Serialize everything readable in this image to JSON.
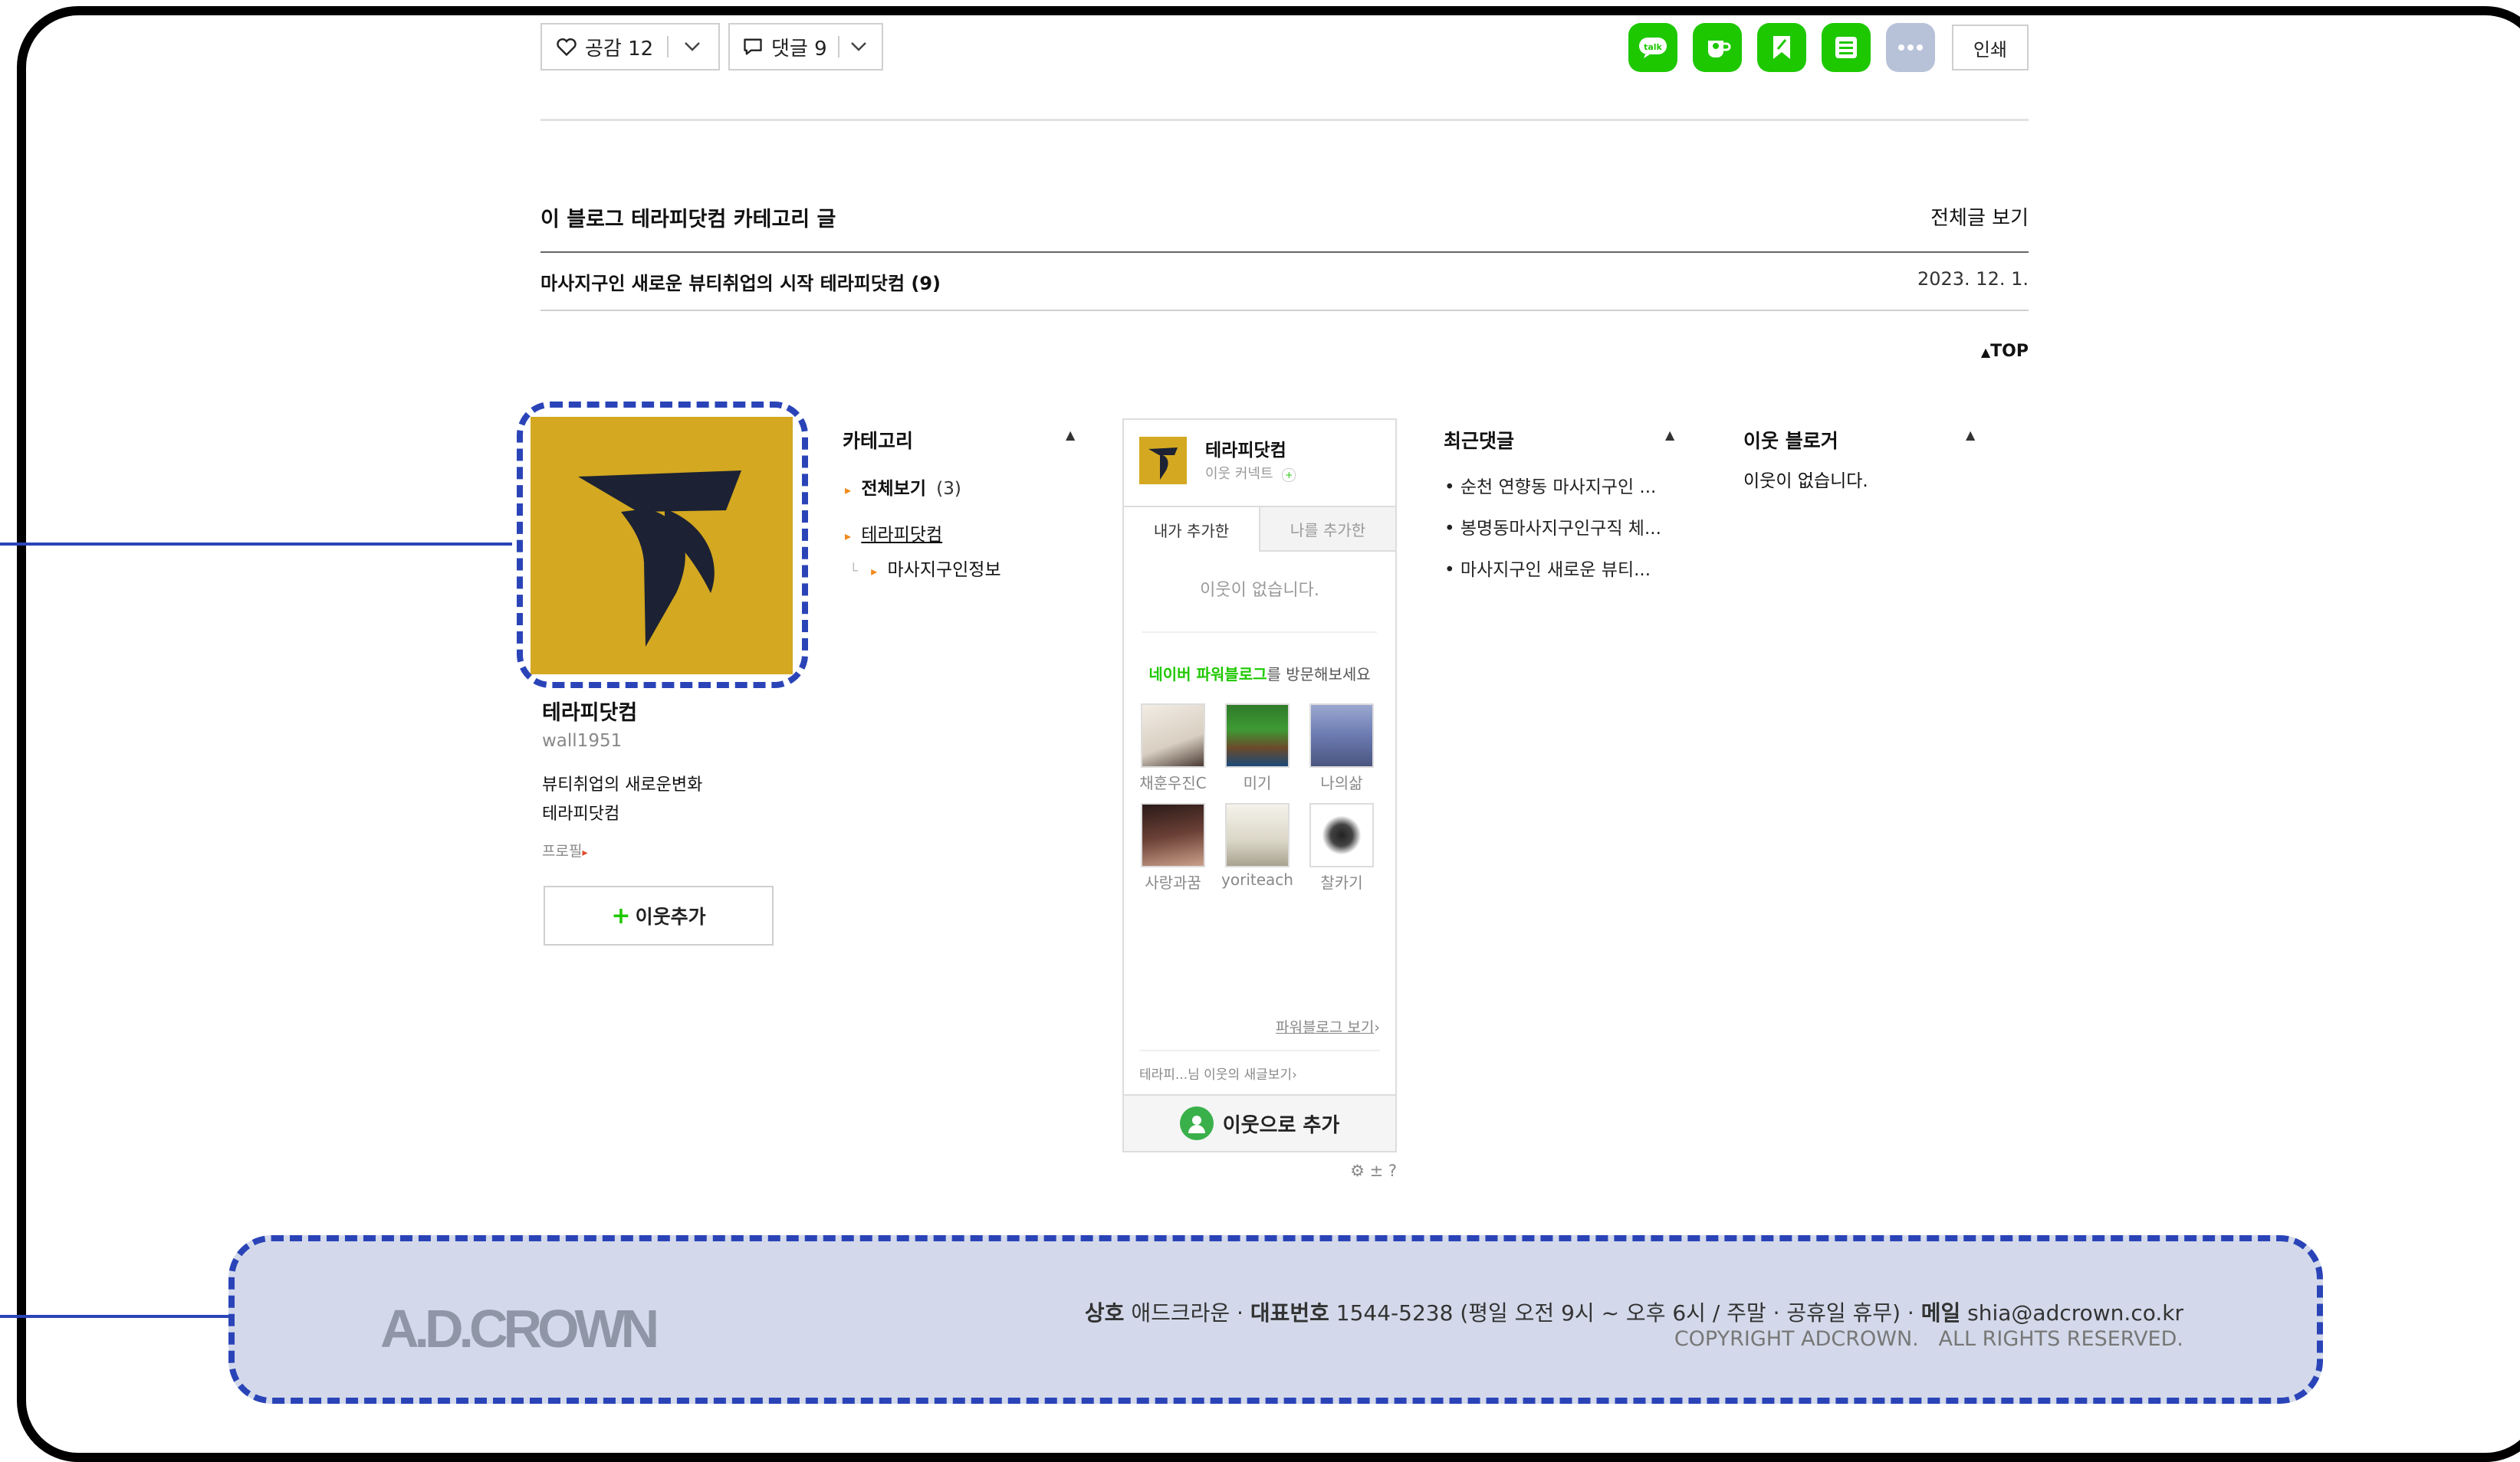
{
  "toolbar": {
    "like_label": "공감 12",
    "comment_label": "댓글 9",
    "print_label": "인쇄"
  },
  "share_icons": [
    {
      "name": "talk-share-icon",
      "color": "#1ec800"
    },
    {
      "name": "cup-share-icon",
      "color": "#1ec800"
    },
    {
      "name": "bookmark-share-icon",
      "color": "#1ec800"
    },
    {
      "name": "list-share-icon",
      "color": "#1ec800"
    },
    {
      "name": "more-icon",
      "color": "#b7c2d8"
    }
  ],
  "category_posts": {
    "heading": "이 블로그 테라피닷컴 카테고리 글",
    "view_all": "전체글 보기",
    "posts": [
      {
        "title": "마사지구인 새로운 뷰티취업의 시작 테라피닷컴 (9)",
        "date": "2023. 12. 1."
      }
    ],
    "top_label": "TOP"
  },
  "profile": {
    "name": "테라피닷컴",
    "id": "wall1951",
    "desc_line1": "뷰티취업의 새로운변화",
    "desc_line2": "테라피닷컴",
    "profile_link": "프로필",
    "add_neighbor": "이웃추가",
    "logo_bg": "#d4a820"
  },
  "category": {
    "title": "카테고리",
    "all": "전체보기",
    "all_count": "(3)",
    "items": [
      "테라피닷컴"
    ],
    "subitems": [
      "마사지구인정보"
    ]
  },
  "widget": {
    "name": "테라피닷컴",
    "sub": "이웃 커넥트",
    "tab1": "내가 추가한",
    "tab2": "나를 추가한",
    "empty": "이웃이 없습니다.",
    "power_prefix": "네이버 파워블로그",
    "power_suffix": "를 방문해보세요",
    "bloggers": [
      "채훈우진C",
      "미기",
      "나의삶",
      "사랑과꿈",
      "yoriteach",
      "찰카기"
    ],
    "power_link": "파워블로그 보기",
    "new_posts": "테라피...님 이웃의 새글보기",
    "add_btn": "이웃으로 추가",
    "settings": "⚙ ± ?"
  },
  "recent_comments": {
    "title": "최근댓글",
    "items": [
      "순천 연향동 마사지구인 ...",
      "봉명동마사지구인구직 체...",
      "마사지구인 새로운 뷰티..."
    ]
  },
  "neighbors": {
    "title": "이웃 블로거",
    "empty": "이웃이 없습니다."
  },
  "footer": {
    "logo": "A.D.CROWN",
    "label_company": "상호",
    "company": "애드크라운",
    "label_phone": "대표번호",
    "phone": "1544-5238",
    "hours": "(평일 오전 9시 ~ 오후 6시 / 주말 · 공휴일 휴무)",
    "label_mail": "메일",
    "mail": "shia@adcrown.co.kr",
    "copyright": "COPYRIGHT ADCROWN.   ALL RIGHTS RESERVED.",
    "bg": "#d3d9ea"
  },
  "annotation_color": "#2a44b8"
}
